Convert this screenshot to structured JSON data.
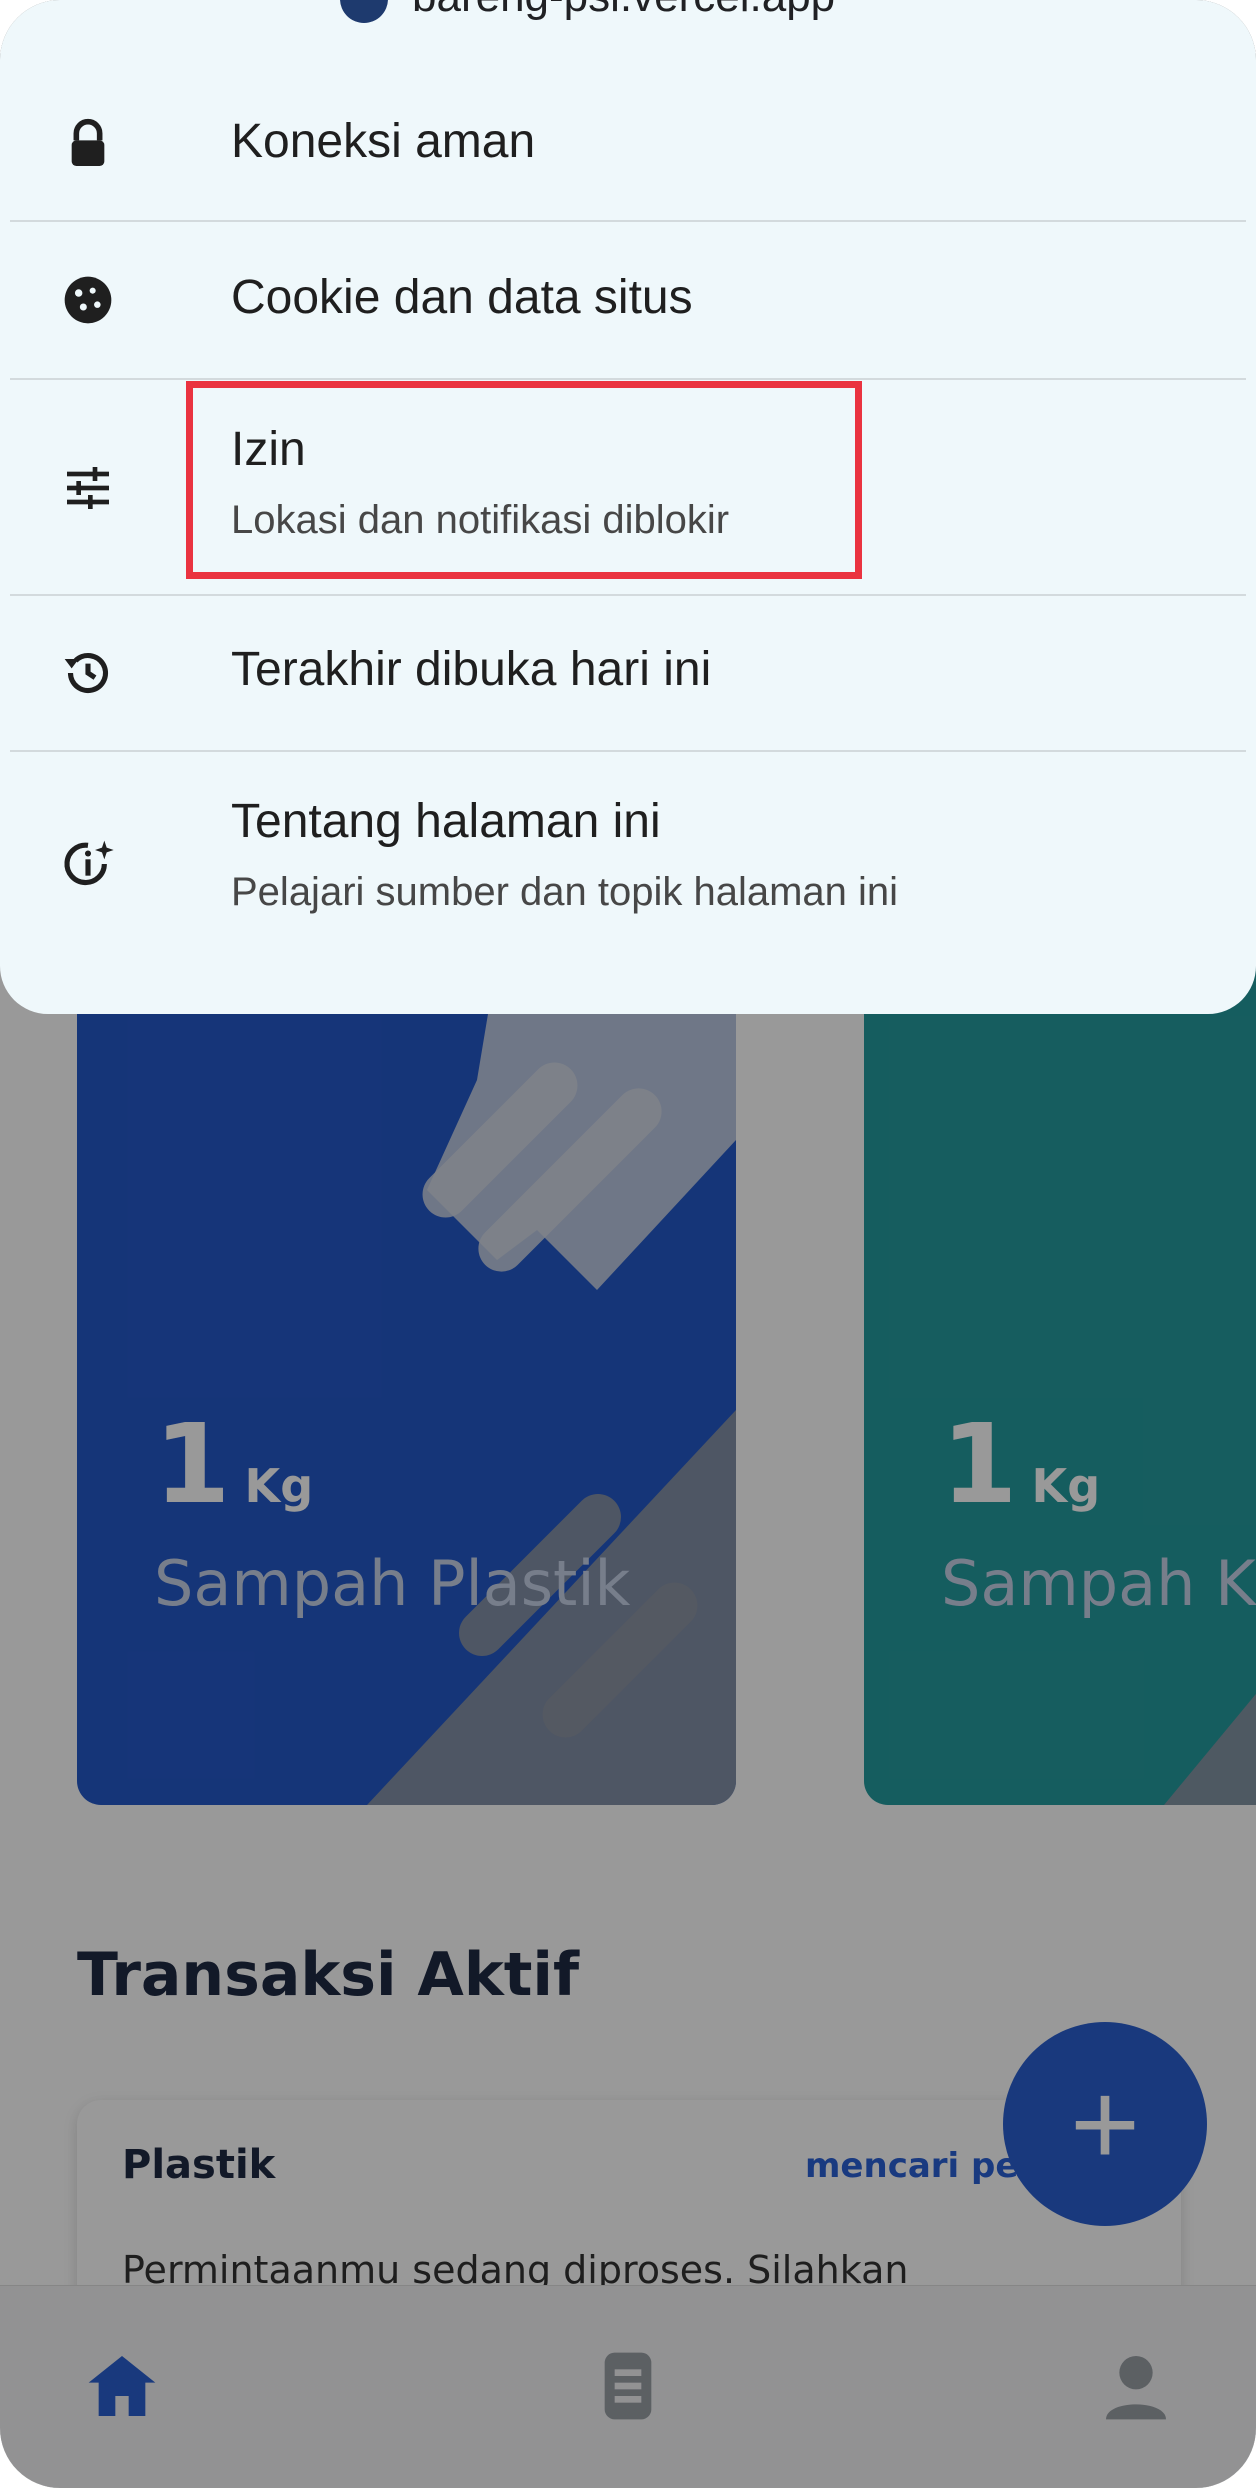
{
  "site_info": {
    "url": "bareng-psi.vercel.app",
    "items": [
      {
        "title": "Koneksi aman",
        "icon": "lock-icon"
      },
      {
        "title": "Cookie dan data situs",
        "icon": "cookie-icon"
      },
      {
        "title": "Izin",
        "subtitle": "Lokasi dan notifikasi diblokir",
        "icon": "tune-icon"
      },
      {
        "title": "Terakhir dibuka hari ini",
        "icon": "history-icon"
      },
      {
        "title": "Tentang halaman ini",
        "subtitle": "Pelajari sumber dan topik halaman ini",
        "icon": "info-sparkle-icon"
      }
    ]
  },
  "cards": [
    {
      "amount": "1",
      "unit": "Kg",
      "label": "Sampah Plastik",
      "color": "#2459c9"
    },
    {
      "amount": "1",
      "unit": "Kg",
      "label": "Sampah Kertas",
      "color": "#249b9e"
    }
  ],
  "section_title": "Transaksi Aktif",
  "transaction": {
    "title": "Plastik",
    "status": "mencari pe",
    "description": "Permintaanmu sedang diproses. Silahkan"
  },
  "fab_label": "+",
  "colors": {
    "highlight": "#ea3340",
    "sheet_bg": "#eff8fb",
    "primary": "#2a5fd1"
  },
  "nav": [
    "home-icon",
    "history-icon",
    "profile-icon"
  ]
}
